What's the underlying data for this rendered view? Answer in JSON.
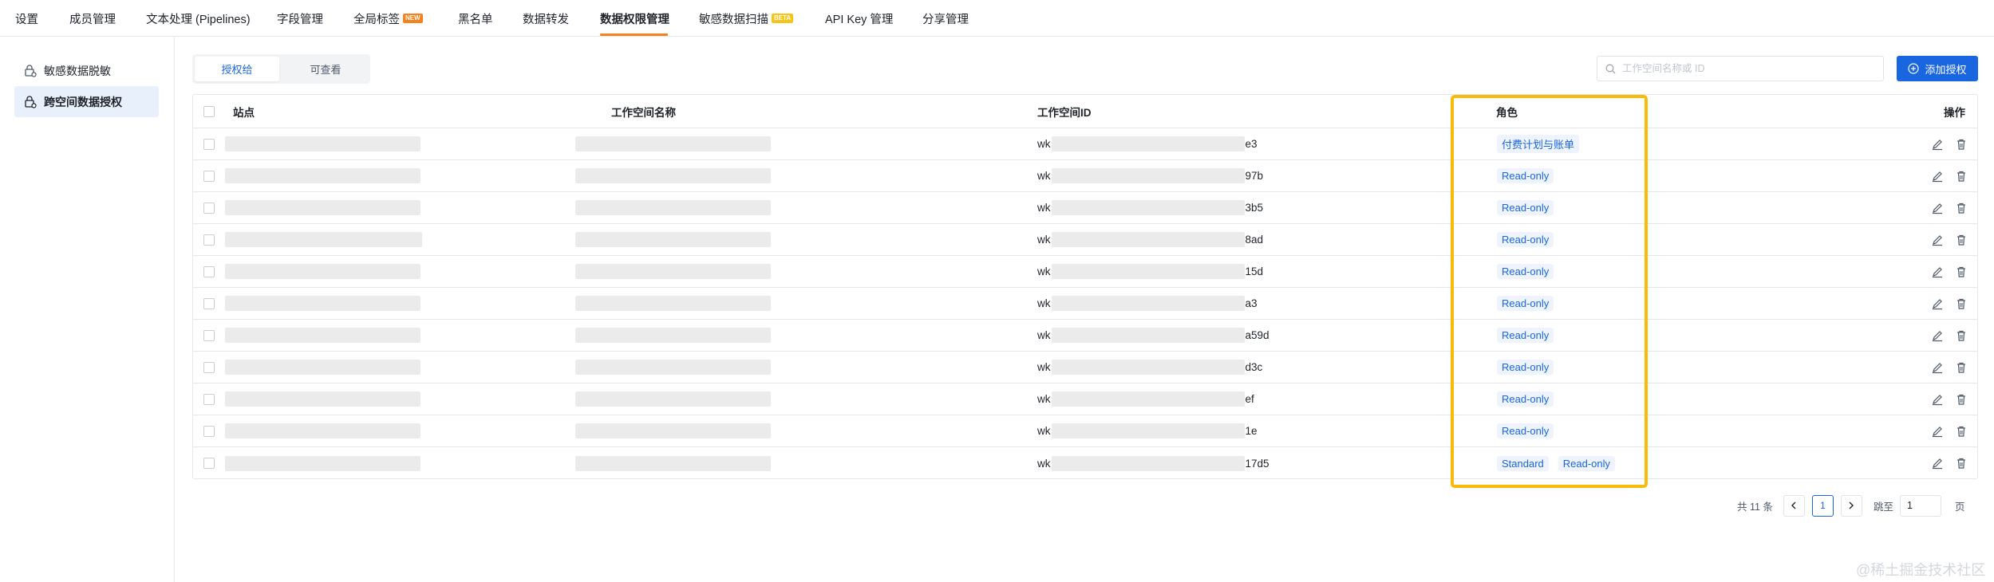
{
  "topnav": {
    "items": [
      {
        "label": "设置"
      },
      {
        "label": "成员管理"
      },
      {
        "label": "文本处理 (Pipelines)"
      },
      {
        "label": "字段管理"
      },
      {
        "label": "全局标签",
        "badge": "NEW"
      },
      {
        "label": "黑名单"
      },
      {
        "label": "数据转发"
      },
      {
        "label": "数据权限管理"
      },
      {
        "label": "敏感数据扫描",
        "badge": "BETA"
      },
      {
        "label": "API Key 管理"
      },
      {
        "label": "分享管理"
      }
    ],
    "active_index": 7
  },
  "sidebar": {
    "items": [
      {
        "label": "敏感数据脱敏",
        "icon": "lock-settings-icon"
      },
      {
        "label": "跨空间数据授权",
        "icon": "lock-share-icon"
      }
    ],
    "active_index": 1
  },
  "tabs": [
    {
      "label": "授权给"
    },
    {
      "label": "可查看"
    }
  ],
  "search": {
    "placeholder": "工作空间名称或 ID"
  },
  "add_button": {
    "label": "添加授权"
  },
  "table": {
    "headers": {
      "site": "站点",
      "workspace_name": "工作空间名称",
      "workspace_id": "工作空间ID",
      "role": "角色",
      "actions": "操作"
    },
    "rows": [
      {
        "id_prefix": "wk",
        "id_suffix": "e3",
        "roles": [
          "付费计划与账单"
        ]
      },
      {
        "id_prefix": "wk",
        "id_suffix": "97b",
        "roles": [
          "Read-only"
        ]
      },
      {
        "id_prefix": "wk",
        "id_suffix": "3b5",
        "roles": [
          "Read-only"
        ]
      },
      {
        "id_prefix": "wk",
        "id_suffix": "8ad",
        "roles": [
          "Read-only"
        ]
      },
      {
        "id_prefix": "wk",
        "id_suffix": "15d",
        "roles": [
          "Read-only"
        ]
      },
      {
        "id_prefix": "wk",
        "id_suffix": "a3",
        "roles": [
          "Read-only"
        ]
      },
      {
        "id_prefix": "wk",
        "id_suffix": "a59d",
        "roles": [
          "Read-only"
        ]
      },
      {
        "id_prefix": "wk",
        "id_suffix": "d3c",
        "roles": [
          "Read-only"
        ]
      },
      {
        "id_prefix": "wk",
        "id_suffix": "ef",
        "roles": [
          "Read-only"
        ]
      },
      {
        "id_prefix": "wk",
        "id_suffix": "1e",
        "roles": [
          "Read-only"
        ]
      },
      {
        "id_prefix": "wk",
        "id_suffix": "17d5",
        "roles": [
          "Standard",
          "Read-only"
        ]
      }
    ]
  },
  "pagination": {
    "total_label": "共 11 条",
    "current_page": "1",
    "jump_label": "跳至",
    "jump_value": "1",
    "page_unit": "页"
  },
  "watermark": "@稀土掘金技术社区",
  "colors": {
    "accent": "#1a66e0",
    "active_tab_underline": "#f5821f",
    "highlight_box": "#f9bb0a"
  }
}
